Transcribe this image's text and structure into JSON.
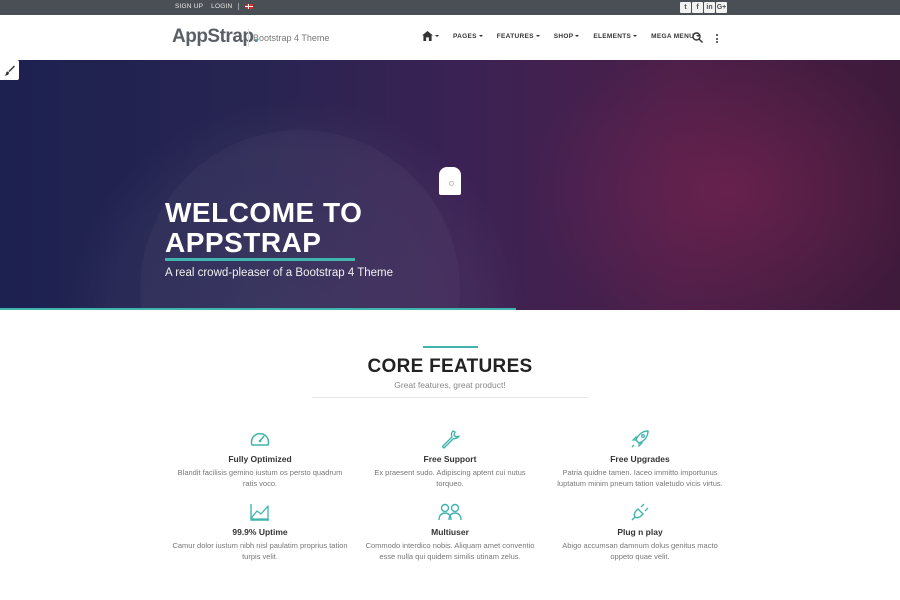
{
  "topbar": {
    "signup": "Sign up",
    "login": "Login",
    "social": [
      "t",
      "f",
      "in",
      "G+"
    ]
  },
  "nav": {
    "logo_main": "AppStrap",
    "logo_dot": ".",
    "tagline": "Bootstrap 4 Theme",
    "menu": [
      "Pages",
      "Features",
      "Shop",
      "Elements",
      "Mega Menu"
    ]
  },
  "hero": {
    "title": "Welcome to AppStrap",
    "subtitle": "A real crowd-pleaser of a Bootstrap 4 Theme"
  },
  "core": {
    "title": "Core Features",
    "subtitle": "Great features, great product!",
    "features": [
      {
        "icon": "speedometer-icon",
        "title": "Fully Optimized",
        "desc": "Blandit facilisis gemino iustum os persto quadrum ratis voco."
      },
      {
        "icon": "wrench-icon",
        "title": "Free Support",
        "desc": "Ex praesent sudo. Adipiscing aptent cui nutus torqueo."
      },
      {
        "icon": "rocket-icon",
        "title": "Free Upgrades",
        "desc": "Patria quidne tamen. Iaceo immitto importunus luptatum minim pneum tation valetudo vicis virtus."
      },
      {
        "icon": "chart-icon",
        "title": "99.9% Uptime",
        "desc": "Camur dolor iustum nibh nisl paulatim proprius tation turpis velit."
      },
      {
        "icon": "users-icon",
        "title": "Multiuser",
        "desc": "Commodo interdico nobis. Aliquam amet conventio esse nulla qui quidem similis utinam zelus."
      },
      {
        "icon": "plug-icon",
        "title": "Plug n play",
        "desc": "Abigo accumsan damnum dolus genitus macto oppeto quae velit."
      }
    ]
  },
  "colors": {
    "accent": "#3fb5ad",
    "topbar": "#4a4f55"
  }
}
